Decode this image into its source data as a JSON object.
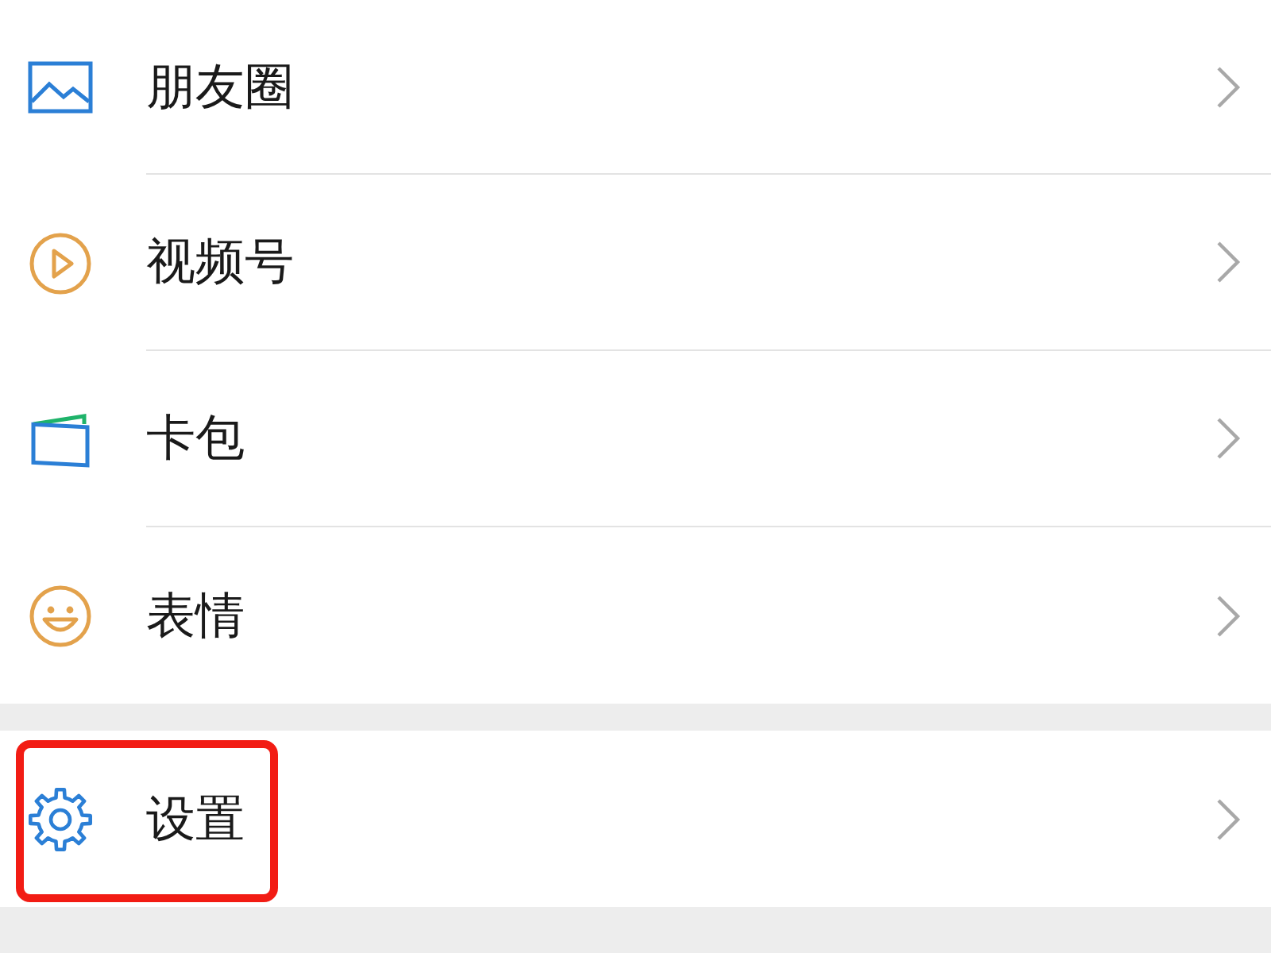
{
  "groups": [
    {
      "items": [
        {
          "kind": "moments",
          "label": "朋友圈",
          "highlighted": false
        },
        {
          "kind": "channels",
          "label": "视频号",
          "highlighted": false
        },
        {
          "kind": "cards",
          "label": "卡包",
          "highlighted": false
        },
        {
          "kind": "stickers",
          "label": "表情",
          "highlighted": false
        }
      ]
    },
    {
      "items": [
        {
          "kind": "settings",
          "label": "设置",
          "highlighted": true
        }
      ]
    }
  ]
}
